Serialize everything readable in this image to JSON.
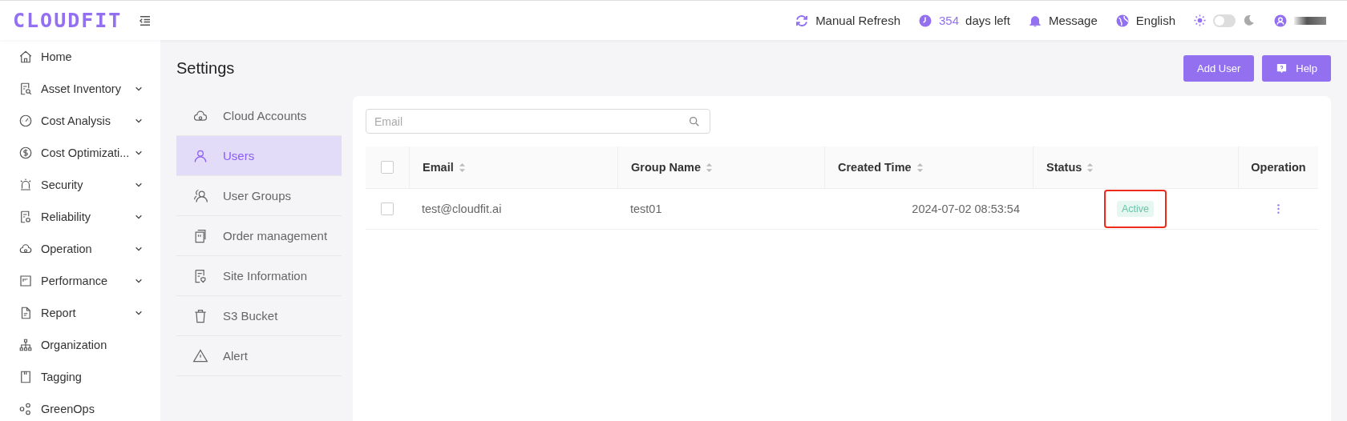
{
  "header": {
    "logo": "CLOUDFIT",
    "manual_refresh": "Manual Refresh",
    "days_count": "354",
    "days_label": "days left",
    "message": "Message",
    "language": "English",
    "dark_mode": false
  },
  "sidebar": {
    "items": [
      {
        "label": "Home",
        "expandable": false
      },
      {
        "label": "Asset Inventory",
        "expandable": true
      },
      {
        "label": "Cost Analysis",
        "expandable": true
      },
      {
        "label": "Cost Optimizati...",
        "expandable": true
      },
      {
        "label": "Security",
        "expandable": true
      },
      {
        "label": "Reliability",
        "expandable": true
      },
      {
        "label": "Operation",
        "expandable": true
      },
      {
        "label": "Performance",
        "expandable": true
      },
      {
        "label": "Report",
        "expandable": true
      },
      {
        "label": "Organization",
        "expandable": false
      },
      {
        "label": "Tagging",
        "expandable": false
      },
      {
        "label": "GreenOps",
        "expandable": false
      }
    ]
  },
  "page": {
    "title": "Settings",
    "buttons": [
      "Add User",
      "Help"
    ]
  },
  "settings_menu": [
    {
      "label": "Cloud Accounts",
      "selected": false
    },
    {
      "label": "Users",
      "selected": true
    },
    {
      "label": "User Groups",
      "selected": false
    },
    {
      "label": "Order management",
      "selected": false
    },
    {
      "label": "Site Information",
      "selected": false
    },
    {
      "label": "S3 Bucket",
      "selected": false
    },
    {
      "label": "Alert",
      "selected": false
    }
  ],
  "search": {
    "placeholder": "Email"
  },
  "table": {
    "all_checked": false,
    "columns": [
      {
        "label": "Email",
        "sortable": true
      },
      {
        "label": "Group Name",
        "sortable": true
      },
      {
        "label": "Created Time",
        "sortable": true
      },
      {
        "label": "Status",
        "sortable": true
      },
      {
        "label": "Operation",
        "sortable": false
      }
    ],
    "rows": [
      {
        "checked": false,
        "email": "test@cloudfit.ai",
        "group": "test01",
        "created": "2024-07-02 08:53:54",
        "status": "Active",
        "status_highlighted": true
      }
    ]
  }
}
